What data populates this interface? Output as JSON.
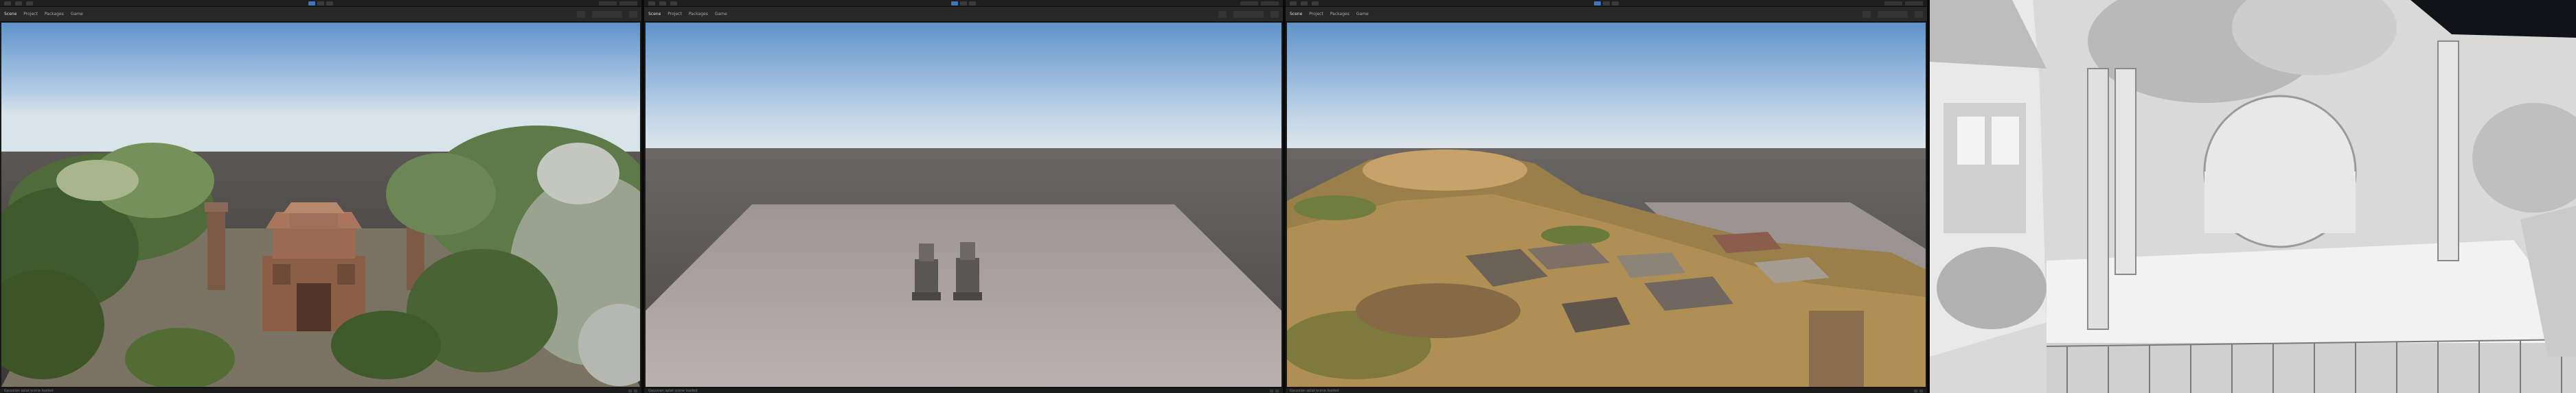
{
  "panels": [
    {
      "id": "p1",
      "scene": "temple-pointcloud",
      "tabs": [
        "Scene",
        "Project",
        "Packages",
        "Game"
      ],
      "statusbar": "Gaussian splat scene loaded",
      "icons": [
        "play-icon",
        "pause-icon",
        "step-icon",
        "layers-icon",
        "layout-icon"
      ]
    },
    {
      "id": "p2",
      "scene": "empty-plane-with-statues",
      "tabs": [
        "Scene",
        "Project",
        "Packages",
        "Game"
      ],
      "statusbar": "Gaussian splat scene loaded",
      "icons": [
        "play-icon",
        "pause-icon",
        "step-icon",
        "layers-icon",
        "layout-icon"
      ]
    },
    {
      "id": "p3",
      "scene": "aerial-village-pointcloud",
      "tabs": [
        "Scene",
        "Project",
        "Packages",
        "Game"
      ],
      "statusbar": "Gaussian splat scene loaded",
      "icons": [
        "play-icon",
        "pause-icon",
        "step-icon",
        "layers-icon",
        "layout-icon"
      ]
    },
    {
      "id": "p4",
      "scene": "grayscale-depth-render",
      "icons": []
    }
  ],
  "colors": {
    "sky_top": "#6e9fd0",
    "sky_horizon": "#cfe0ee",
    "ground_dark": "#4a4645",
    "plane": "#a9a1a0",
    "editor_bg": "#191919",
    "accent_blue": "#3a79bb"
  }
}
